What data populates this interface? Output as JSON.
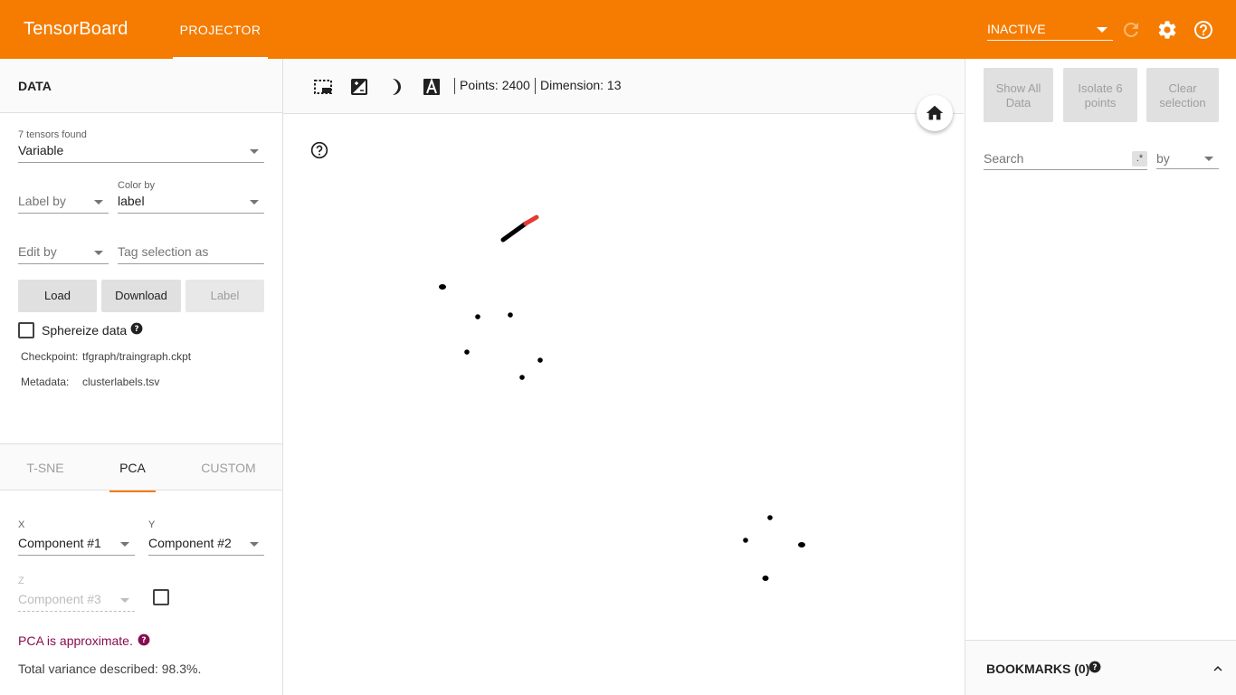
{
  "app": {
    "brand": "TensorBoard",
    "tab": "PROJECTOR",
    "status": "INACTIVE",
    "accent_color": "#f57c00"
  },
  "data_panel": {
    "header": "DATA",
    "tensor_count_label": "7 tensors found",
    "tensor_value": "Variable",
    "label_by_placeholder": "Label by",
    "color_by_label": "Color by",
    "color_by_value": "label",
    "edit_by_placeholder": "Edit by",
    "tag_selection_placeholder": "Tag selection as",
    "load_button": "Load",
    "download_button": "Download",
    "label_button": "Label",
    "sphereize_label": "Sphereize data",
    "checkpoint_label": "Checkpoint:",
    "checkpoint_value": "tfgraph/traingraph.ckpt",
    "metadata_label": "Metadata:",
    "metadata_value": "clusterlabels.tsv"
  },
  "projection_tabs": [
    {
      "label": "T-SNE",
      "active": false
    },
    {
      "label": "PCA",
      "active": true
    },
    {
      "label": "CUSTOM",
      "active": false
    }
  ],
  "pca": {
    "x_label": "X",
    "x_value": "Component #1",
    "y_label": "Y",
    "y_value": "Component #2",
    "z_label": "Z",
    "z_value": "Component #3",
    "approx_note": "PCA is approximate.",
    "variance_text": "Total variance described: 98.3%."
  },
  "toolbar": {
    "points_text": "Points: 2400",
    "dimension_text": "Dimension: 13"
  },
  "inspector": {
    "show_all_button": "Show All Data",
    "isolate_button": "Isolate 6 points",
    "clear_button": "Clear selection",
    "search_placeholder": "Search",
    "regex_label": ".*",
    "by_placeholder": "by",
    "bookmarks_label": "BOOKMARKS (0)"
  },
  "icons": {
    "top": [
      "refresh-icon",
      "settings-icon",
      "help-icon"
    ],
    "toolbar": [
      "selection-box-icon",
      "night-mode-icon",
      "label-mode-icon",
      "contrast-icon"
    ]
  }
}
